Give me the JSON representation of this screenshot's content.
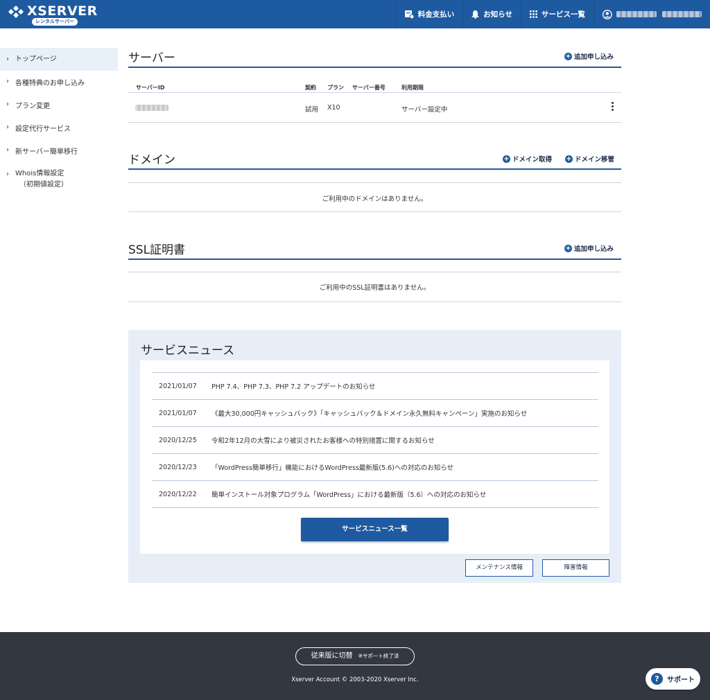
{
  "header": {
    "logo_text": "XSERVER",
    "logo_sub": "レンタルサーバー",
    "nav": [
      {
        "label": "料金支払い",
        "icon": "payment-icon"
      },
      {
        "label": "お知らせ",
        "icon": "bell-icon"
      },
      {
        "label": "サービス一覧",
        "icon": "grid-icon"
      }
    ],
    "user_icon": "user-icon"
  },
  "sidebar": {
    "items": [
      {
        "label": "トップページ"
      },
      {
        "label": "各種特典のお申し込み"
      },
      {
        "label": "プラン変更"
      },
      {
        "label": "設定代行サービス"
      },
      {
        "label": "新サーバー簡単移行"
      },
      {
        "label": "Whois情報設定",
        "sub": "（初期値設定）"
      }
    ]
  },
  "server": {
    "title": "サーバー",
    "add_label": "追加申し込み",
    "columns": [
      "サーバーID",
      "契約",
      "プラン",
      "サーバー番号",
      "利用期限"
    ],
    "row": {
      "contract": "試用",
      "plan": "X10",
      "status": "サーバー設定中"
    }
  },
  "domain": {
    "title": "ドメイン",
    "acquire_label": "ドメイン取得",
    "transfer_label": "ドメイン移管",
    "empty": "ご利用中のドメインはありません。"
  },
  "ssl": {
    "title": "SSL証明書",
    "add_label": "追加申し込み",
    "empty": "ご利用中のSSL証明書はありません。"
  },
  "news": {
    "title": "サービスニュース",
    "items": [
      {
        "date": "2021/01/07",
        "text": "PHP 7.4、PHP 7.3、PHP 7.2 アップデートのお知らせ"
      },
      {
        "date": "2021/01/07",
        "text": "《最大30,000円キャッシュバック》「キャッシュバック＆ドメイン永久無料キャンペーン」実施のお知らせ"
      },
      {
        "date": "2020/12/25",
        "text": "令和2年12月の大雪により被災されたお客様への特別措置に関するお知らせ"
      },
      {
        "date": "2020/12/23",
        "text": "「WordPress簡単移行」機能におけるWordPress最新版(5.6)への対応のお知らせ"
      },
      {
        "date": "2020/12/22",
        "text": "簡単インストール対象プログラム「WordPress」における最新版（5.6）への対応のお知らせ"
      }
    ],
    "list_button": "サービスニュース一覧",
    "maintenance_button": "メンテナンス情報",
    "failure_button": "障害情報"
  },
  "footer": {
    "switch_label": "従来版に切替",
    "switch_note": "※サポート終了済",
    "copyright": "Xserver Account © 2003-2020 Xserver Inc.",
    "support_label": "サポート"
  },
  "colors": {
    "primary": "#1e5aa0",
    "footer_bg": "#333740",
    "news_bg": "#e7eef8"
  }
}
